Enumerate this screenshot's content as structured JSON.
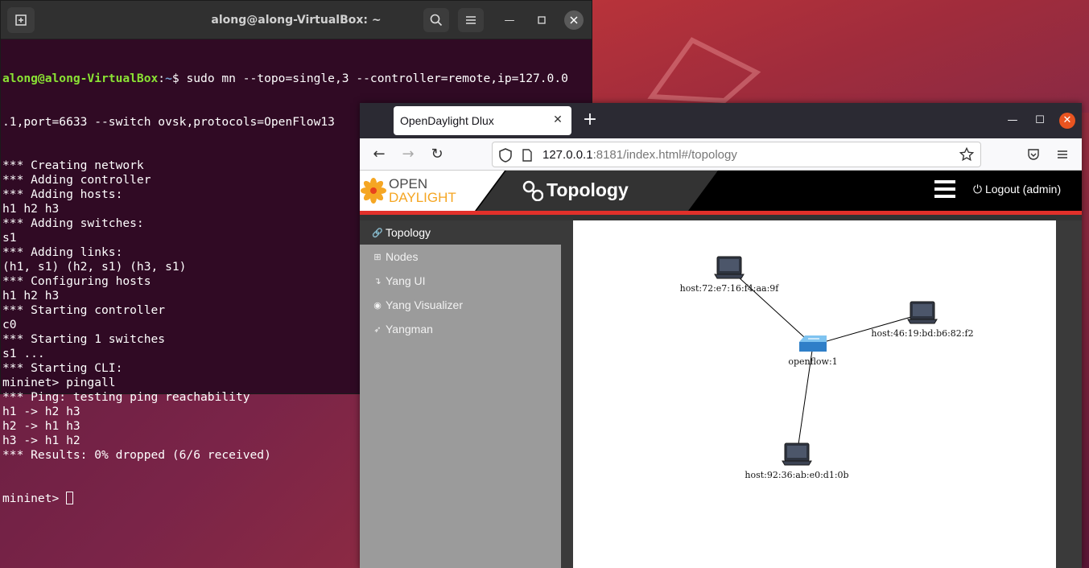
{
  "terminal": {
    "title": "along@along-VirtualBox: ~",
    "prompt_user": "along@along-VirtualBox",
    "prompt_path": "~",
    "command_line_1": "$ sudo mn --topo=single,3 --controller=remote,ip=127.0.0",
    "command_line_2": ".1,port=6633 --switch ovsk,protocols=OpenFlow13",
    "output": [
      "*** Creating network",
      "*** Adding controller",
      "*** Adding hosts:",
      "h1 h2 h3",
      "*** Adding switches:",
      "s1",
      "*** Adding links:",
      "(h1, s1) (h2, s1) (h3, s1)",
      "*** Configuring hosts",
      "h1 h2 h3",
      "*** Starting controller",
      "c0",
      "*** Starting 1 switches",
      "s1 ...",
      "*** Starting CLI:",
      "mininet> pingall",
      "*** Ping: testing ping reachability",
      "h1 -> h2 h3",
      "h2 -> h1 h3",
      "h3 -> h1 h2",
      "*** Results: 0% dropped (6/6 received)"
    ],
    "final_prompt": "mininet> "
  },
  "browser": {
    "tab_title": "OpenDaylight Dlux",
    "url_host": "127.0.0.1",
    "url_rest": ":8181/index.html#/topology"
  },
  "odl": {
    "logo_line1": "OPEN",
    "logo_line2": "DAYLIGHT",
    "page_title": "Topology",
    "logout": "Logout (admin)",
    "sidebar": [
      {
        "label": "Topology",
        "icon": "link-icon",
        "glyph": "🔗"
      },
      {
        "label": "Nodes",
        "icon": "sitemap-icon",
        "glyph": "⊞"
      },
      {
        "label": "Yang UI",
        "icon": "arrow-icon",
        "glyph": "↴"
      },
      {
        "label": "Yang Visualizer",
        "icon": "eye-icon",
        "glyph": "◉"
      },
      {
        "label": "Yangman",
        "icon": "rocket-icon",
        "glyph": "➶"
      }
    ]
  },
  "topology": {
    "nodes": [
      {
        "id": "host:72:e7:16:f4:aa:9f",
        "type": "host"
      },
      {
        "id": "host:46:19:bd:b6:82:f2",
        "type": "host"
      },
      {
        "id": "openflow:1",
        "type": "switch"
      },
      {
        "id": "host:92:36:ab:e0:d1:0b",
        "type": "host"
      }
    ],
    "links": [
      [
        "host:72:e7:16:f4:aa:9f",
        "openflow:1"
      ],
      [
        "host:46:19:bd:b6:82:f2",
        "openflow:1"
      ],
      [
        "host:92:36:ab:e0:d1:0b",
        "openflow:1"
      ]
    ]
  }
}
